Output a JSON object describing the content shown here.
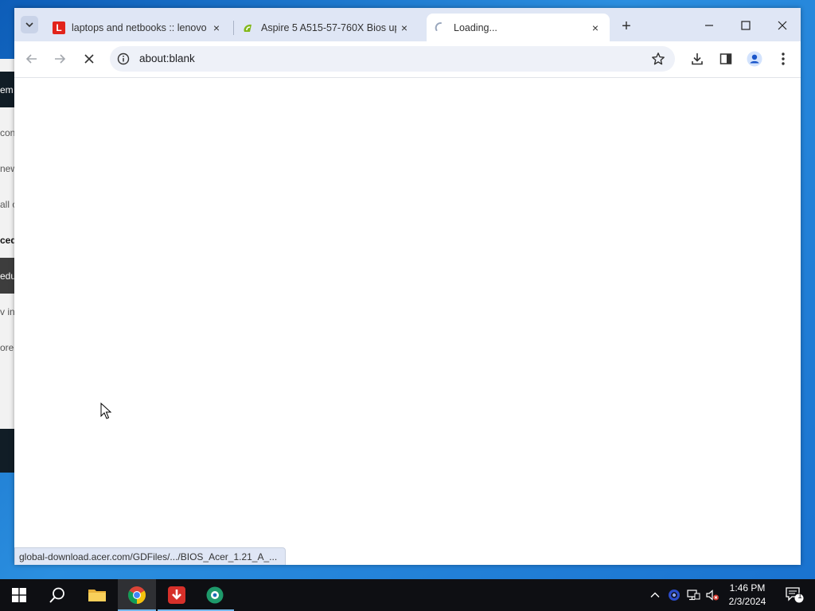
{
  "background_window": {
    "rows": [
      "em",
      "con",
      "new",
      "all c",
      "ced",
      "edu",
      "v in",
      "ore"
    ]
  },
  "browser": {
    "tabs": [
      {
        "title": "laptops and netbooks :: lenovo",
        "favicon": "L",
        "close": "×"
      },
      {
        "title": "Aspire 5 A515-57-760X Bios up",
        "favicon": "acer-icon",
        "close": "×"
      },
      {
        "title": "Loading...",
        "favicon": "spinner-icon",
        "close": "×",
        "active": true
      }
    ],
    "new_tab": "+",
    "address": "about:blank",
    "status_url": "global-download.acer.com/GDFiles/.../BIOS_Acer_1.21_A_...",
    "accent": "#dfe6f5"
  },
  "taskbar": {
    "clock_time": "1:46 PM",
    "clock_date": "2/3/2024",
    "notification_count": "1"
  }
}
